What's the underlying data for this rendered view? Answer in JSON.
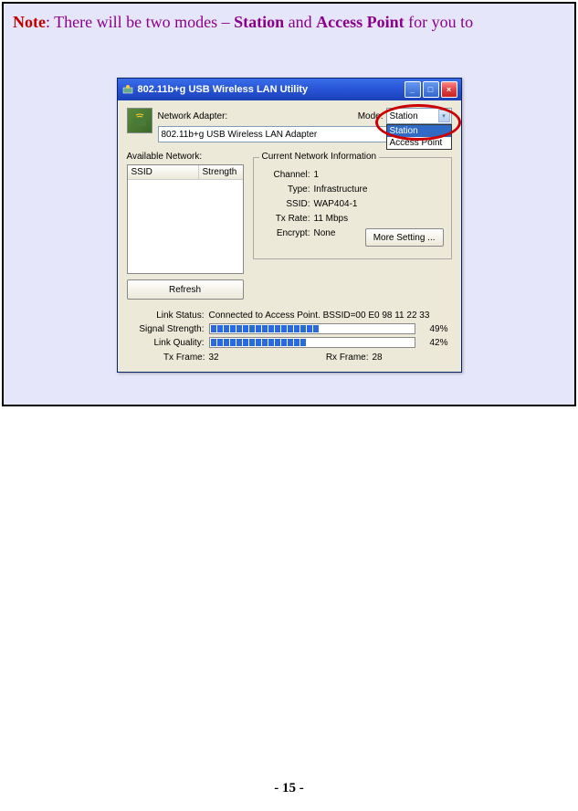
{
  "note": {
    "label": "Note",
    "text_middle": ": There will be two modes – ",
    "bold1": "Station",
    "text_and": " and ",
    "bold2": "Access Point",
    "text_end": " for you to"
  },
  "window": {
    "title": "802.11b+g USB Wireless LAN Utility",
    "adapter_label": "Network Adapter:",
    "adapter_value": "802.11b+g USB Wireless LAN Adapter",
    "mode_label": "Mode:",
    "mode_value": "Station",
    "mode_options": [
      "Station",
      "Access Point"
    ],
    "available_label": "Available Network:",
    "list_headers": {
      "ssid": "SSID",
      "strength": "Strength"
    },
    "refresh": "Refresh",
    "group_title": "Current Network Information",
    "info": {
      "channel_lbl": "Channel:",
      "channel_val": "1",
      "type_lbl": "Type:",
      "type_val": "Infrastructure",
      "ssid_lbl": "SSID:",
      "ssid_val": "WAP404-1",
      "txrate_lbl": "Tx Rate:",
      "txrate_val": "11 Mbps",
      "encrypt_lbl": "Encrypt:",
      "encrypt_val": "None"
    },
    "more_setting": "More Setting ...",
    "stats": {
      "link_lbl": "Link Status:",
      "link_val": "Connected to Access Point. BSSID=00 E0 98 11 22 33",
      "signal_lbl": "Signal Strength:",
      "signal_pct": "49%",
      "signal_segs": 17,
      "quality_lbl": "Link Quality:",
      "quality_pct": "42%",
      "quality_segs": 15,
      "txframe_lbl": "Tx Frame:",
      "txframe_val": "32",
      "rxframe_lbl": "Rx Frame:",
      "rxframe_val": "28"
    }
  },
  "page_number": "- 15 -"
}
